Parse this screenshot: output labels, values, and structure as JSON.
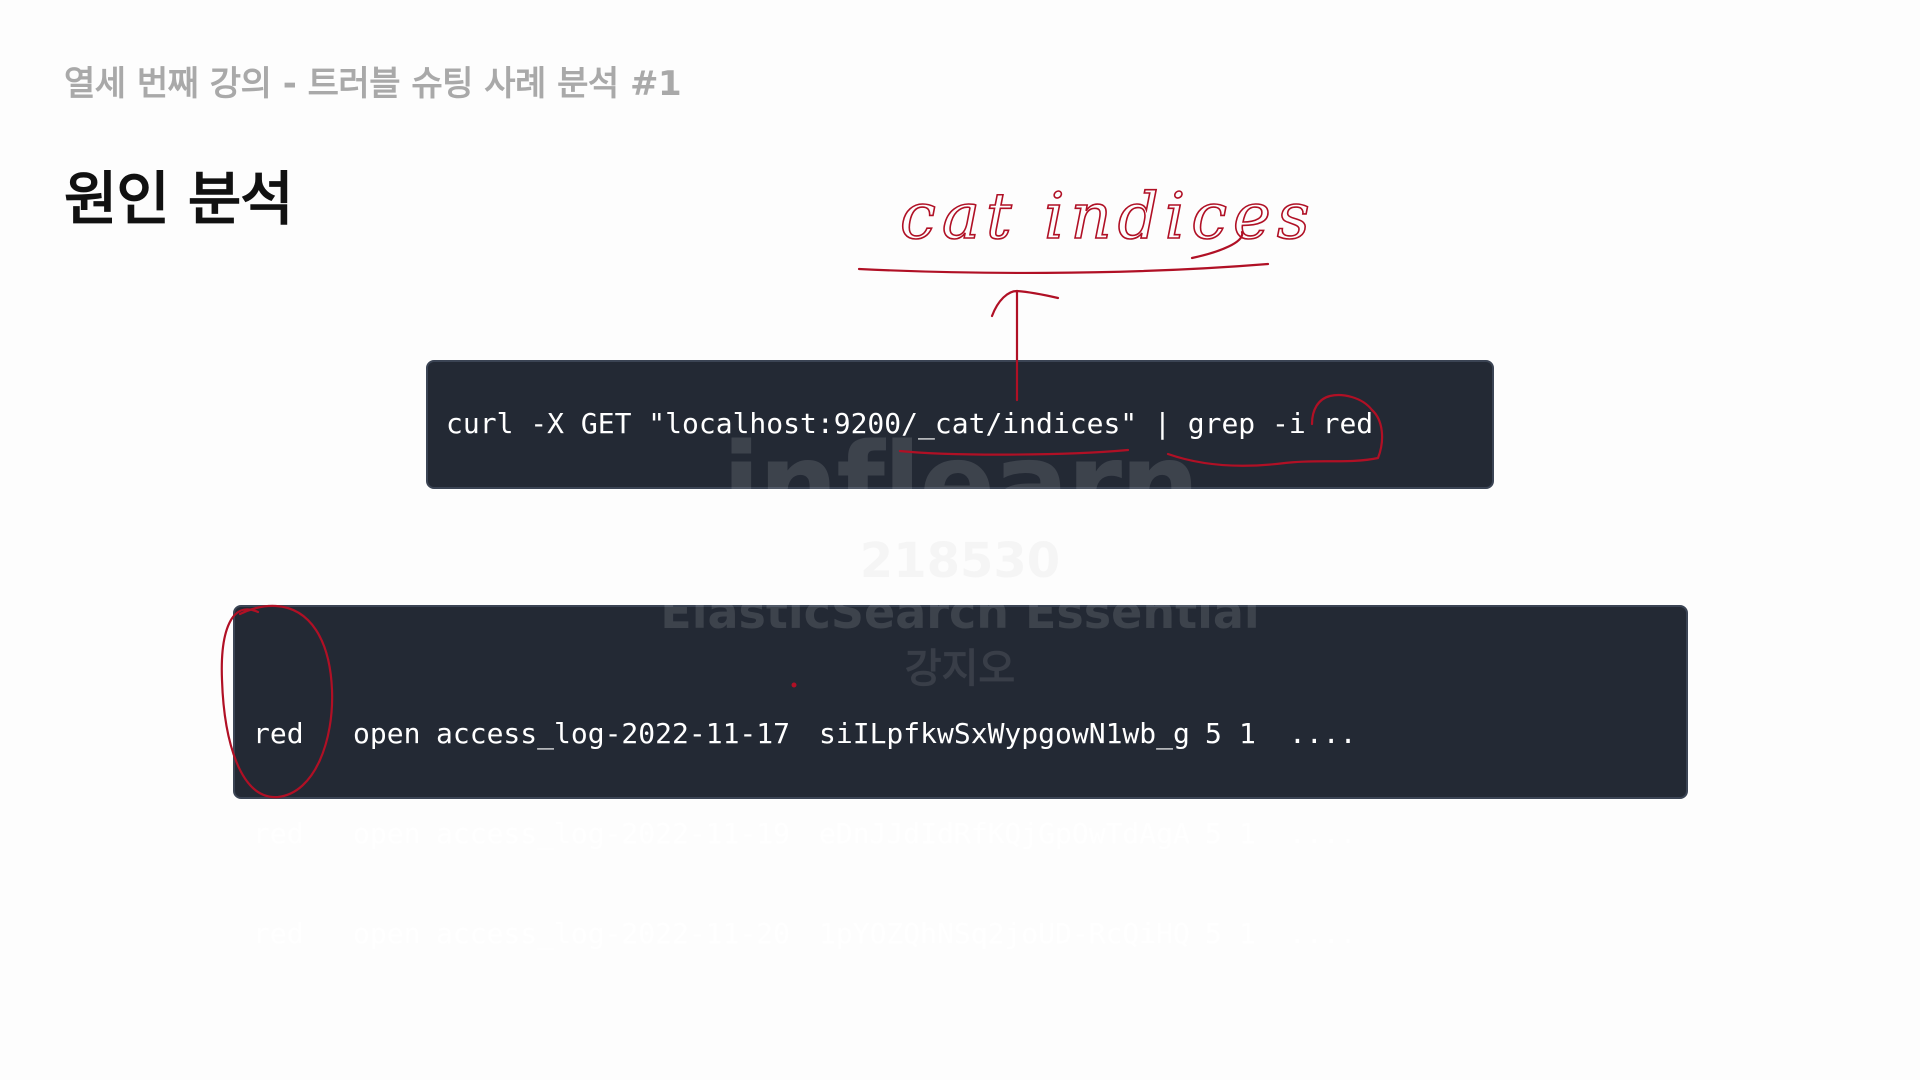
{
  "slide": {
    "subtitle": "열세 번째 강의 - 트러블 슈팅 사례 분석 #1",
    "title": "원인 분석"
  },
  "command": {
    "text": "curl -X GET \"localhost:9200/_cat/indices\" | grep -i red"
  },
  "results": {
    "rows": [
      {
        "health": "red",
        "status": "open",
        "index": "access_log-2022-11-17",
        "uuid": "siILpfkwSxWypgowN1wb_g",
        "pri": "5",
        "rep": "1",
        "more": "...."
      },
      {
        "health": "red",
        "status": "open",
        "index": "access_log-2022-11-19",
        "uuid": "eDnJJdIdRfKQjGpOwTdAgA",
        "pri": "5",
        "rep": "1",
        "more": "...."
      },
      {
        "health": "red",
        "status": "open",
        "index": "access_log-2022-11-20",
        "uuid": "1pYOZQhNSq2joUD-RcQiHQ",
        "pri": "5",
        "rep": "1",
        "more": "...."
      }
    ]
  },
  "annotations": {
    "handwritten_note": "cat indices",
    "ink_color": "#b01025"
  },
  "watermark": {
    "logo": "inflearn",
    "id": "218530",
    "course": "ElasticSearch Essential",
    "name": "강지오"
  }
}
